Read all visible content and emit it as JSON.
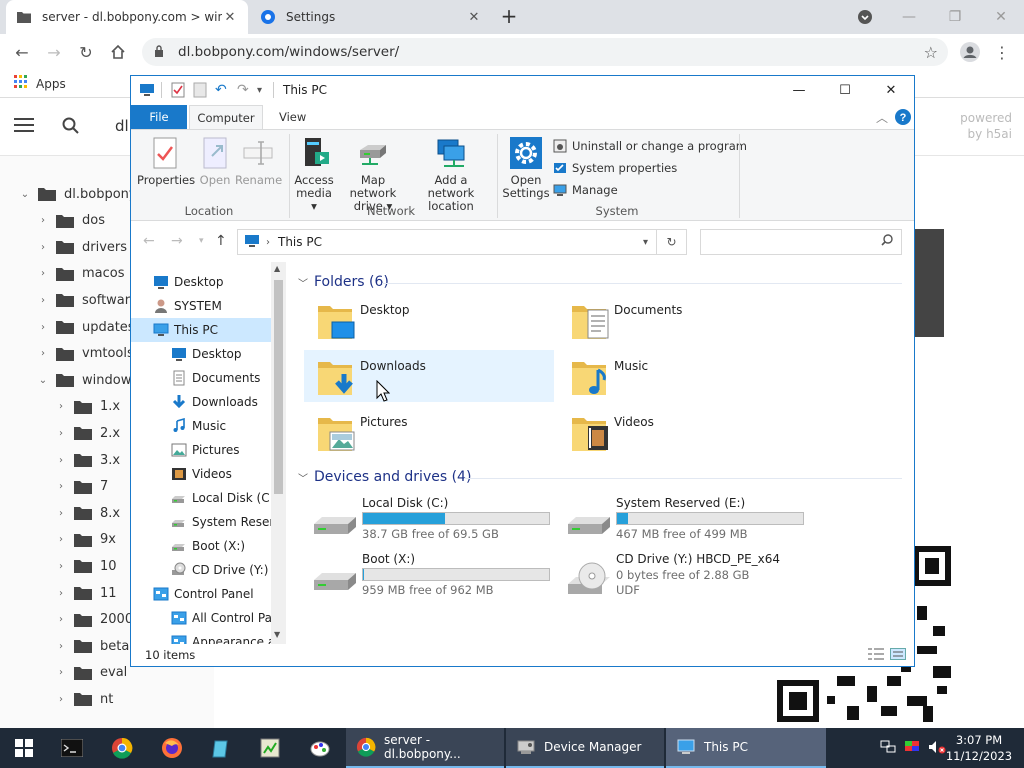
{
  "browser": {
    "tabs": [
      {
        "title": "server - dl.bobpony.com > windo",
        "active": true
      },
      {
        "title": "Settings",
        "active": false
      }
    ],
    "url": "dl.bobpony.com/windows/server/",
    "bookmarks": {
      "apps": "Apps"
    }
  },
  "webpage": {
    "header_partial": "dl",
    "powered_line1": "powered",
    "powered_line2": "by h5ai",
    "tree": [
      {
        "label": "dl.bobpony",
        "expanded": true,
        "level": 0
      },
      {
        "label": "dos",
        "level": 1
      },
      {
        "label": "drivers",
        "level": 1
      },
      {
        "label": "macos",
        "level": 1
      },
      {
        "label": "softwar",
        "level": 1
      },
      {
        "label": "updates",
        "level": 1
      },
      {
        "label": "vmtools",
        "level": 1
      },
      {
        "label": "window",
        "expanded": true,
        "level": 1
      },
      {
        "label": "1.x",
        "level": 2
      },
      {
        "label": "2.x",
        "level": 2
      },
      {
        "label": "3.x",
        "level": 2
      },
      {
        "label": "7",
        "level": 2
      },
      {
        "label": "8.x",
        "level": 2
      },
      {
        "label": "9x",
        "level": 2
      },
      {
        "label": "10",
        "level": 2
      },
      {
        "label": "11",
        "level": 2
      },
      {
        "label": "2000",
        "level": 2
      },
      {
        "label": "beta",
        "level": 2
      },
      {
        "label": "eval",
        "level": 2
      },
      {
        "label": "nt",
        "level": 2
      }
    ]
  },
  "explorer": {
    "title": "This PC",
    "ribbon_tabs": {
      "file": "File",
      "computer": "Computer",
      "view": "View"
    },
    "ribbon": {
      "location": {
        "label": "Location",
        "properties": "Properties",
        "open": "Open",
        "rename": "Rename"
      },
      "network": {
        "label": "Network",
        "access_media_1": "Access",
        "access_media_2": "media ▾",
        "map_drive_1": "Map network",
        "map_drive_2": "drive ▾",
        "add_location_1": "Add a network",
        "add_location_2": "location"
      },
      "system": {
        "label": "System",
        "open_settings_1": "Open",
        "open_settings_2": "Settings",
        "uninstall": "Uninstall or change a program",
        "sys_props": "System properties",
        "manage": "Manage"
      }
    },
    "address": {
      "path": "This PC",
      "search_placeholder": ""
    },
    "nav_pane": [
      {
        "label": "Desktop",
        "icon": "desktop-icon",
        "indent": 0
      },
      {
        "label": "SYSTEM",
        "icon": "user-icon",
        "indent": 0
      },
      {
        "label": "This PC",
        "icon": "computer-icon",
        "indent": 0,
        "selected": true
      },
      {
        "label": "Desktop",
        "icon": "desktop-icon",
        "indent": 1
      },
      {
        "label": "Documents",
        "icon": "documents-icon",
        "indent": 1
      },
      {
        "label": "Downloads",
        "icon": "downloads-icon",
        "indent": 1
      },
      {
        "label": "Music",
        "icon": "music-icon",
        "indent": 1
      },
      {
        "label": "Pictures",
        "icon": "pictures-icon",
        "indent": 1
      },
      {
        "label": "Videos",
        "icon": "videos-icon",
        "indent": 1
      },
      {
        "label": "Local Disk (C:)",
        "icon": "drive-icon",
        "indent": 1
      },
      {
        "label": "System Reserve",
        "icon": "drive-icon",
        "indent": 1
      },
      {
        "label": "Boot (X:)",
        "icon": "drive-icon",
        "indent": 1
      },
      {
        "label": "CD Drive (Y:) H",
        "icon": "cd-icon",
        "indent": 1
      },
      {
        "label": "Control Panel",
        "icon": "control-panel-icon",
        "indent": 0
      },
      {
        "label": "All Control Par",
        "icon": "control-panel-icon",
        "indent": 1
      },
      {
        "label": "Appearance an",
        "icon": "control-panel-icon",
        "indent": 1
      }
    ],
    "folders_heading": "Folders (6)",
    "folders": [
      {
        "name": "Desktop",
        "icon": "desktop-folder-icon"
      },
      {
        "name": "Documents",
        "icon": "documents-folder-icon"
      },
      {
        "name": "Downloads",
        "icon": "downloads-folder-icon",
        "hover": true
      },
      {
        "name": "Music",
        "icon": "music-folder-icon"
      },
      {
        "name": "Pictures",
        "icon": "pictures-folder-icon"
      },
      {
        "name": "Videos",
        "icon": "videos-folder-icon"
      }
    ],
    "drives_heading": "Devices and drives (4)",
    "drives": [
      {
        "name": "Local Disk (C:)",
        "free": "38.7 GB free of 69.5 GB",
        "used_fraction": 0.44
      },
      {
        "name": "System Reserved (E:)",
        "free": "467 MB free of 499 MB",
        "used_fraction": 0.06
      },
      {
        "name": "Boot (X:)",
        "free": "959 MB free of 962 MB",
        "used_fraction": 0.003
      },
      {
        "name": "CD Drive (Y:) HBCD_PE_x64",
        "free": "0 bytes free of 2.88 GB",
        "fs": "UDF"
      }
    ],
    "status": "10 items"
  },
  "taskbar": {
    "tasks": [
      {
        "label": "server - dl.bobpony...",
        "icon": "chrome-icon"
      },
      {
        "label": "Device Manager",
        "icon": "device-manager-icon"
      },
      {
        "label": "This PC",
        "icon": "this-pc-icon",
        "active": true
      }
    ],
    "time": "3:07 PM",
    "date": "11/12/2023"
  },
  "colors": {
    "accent": "#1979ca",
    "drive_fill": "#26a0da",
    "taskbar": "#1f2a38",
    "nav_selected": "#cce8ff"
  }
}
